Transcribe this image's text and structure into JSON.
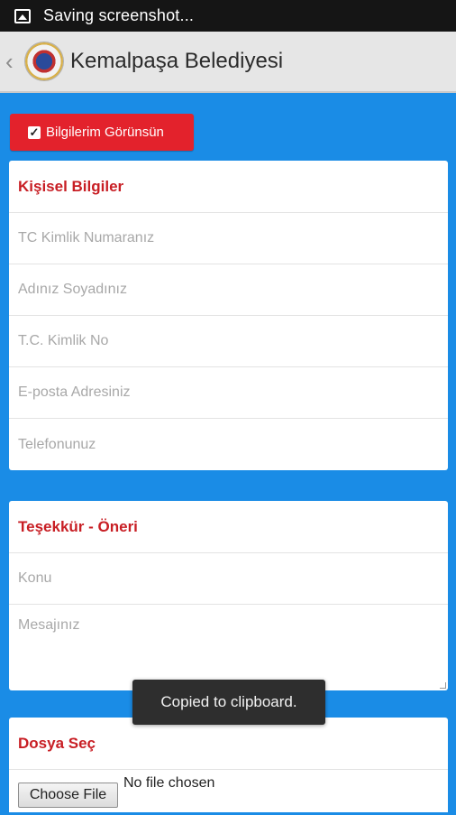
{
  "status_bar": {
    "text": "Saving screenshot...",
    "icon": "image-icon"
  },
  "action_bar": {
    "title": "Kemalpaşa Belediyesi",
    "back_icon": "chevron-left-icon",
    "logo": "municipality-logo"
  },
  "visibility_button": {
    "label": "Bilgilerim Görünsün",
    "checked": true,
    "check_glyph": "✓"
  },
  "personal_section": {
    "title": "Kişisel Bilgiler",
    "fields": [
      {
        "placeholder": "TC Kimlik Numaranız"
      },
      {
        "placeholder": "Adınız Soyadınız"
      },
      {
        "placeholder": "T.C. Kimlik No"
      },
      {
        "placeholder": "E-posta Adresiniz"
      },
      {
        "placeholder": "Telefonunuz"
      }
    ]
  },
  "feedback_section": {
    "title": "Teşekkür - Öneri",
    "subject_placeholder": "Konu",
    "message_placeholder": "Mesajınız"
  },
  "file_section": {
    "title": "Dosya Seç",
    "choose_label": "Choose File",
    "status": "No file chosen"
  },
  "toast": {
    "text": "Copied to clipboard."
  },
  "colors": {
    "background": "#1a8ce6",
    "accent_red": "#e3222c",
    "header_red": "#c81e24"
  }
}
